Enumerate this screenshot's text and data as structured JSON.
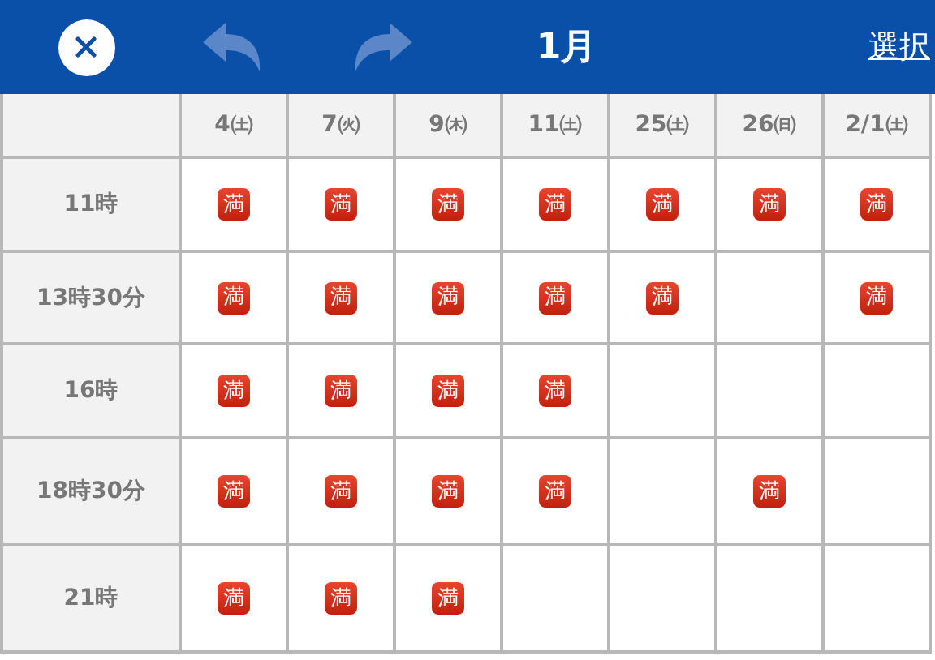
{
  "toolbar": {
    "close_disabled": false,
    "undo_disabled": true,
    "redo_disabled": true,
    "title": "1月",
    "select_label": "選択"
  },
  "table": {
    "columns": [
      "4㈯",
      "7㈫",
      "9㈭",
      "11㈯",
      "25㈯",
      "26㈰",
      "2/1㈯"
    ],
    "rows": [
      {
        "time": "11時",
        "cells": [
          "満",
          "満",
          "満",
          "満",
          "満",
          "満",
          "満"
        ]
      },
      {
        "time": "13時30分",
        "cells": [
          "満",
          "満",
          "満",
          "満",
          "満",
          null,
          "満"
        ]
      },
      {
        "time": "16時",
        "cells": [
          "満",
          "満",
          "満",
          "満",
          null,
          null,
          null
        ]
      },
      {
        "time": "18時30分",
        "cells": [
          "満",
          "満",
          "満",
          "満",
          null,
          "満",
          null
        ]
      },
      {
        "time": "21時",
        "cells": [
          "満",
          "満",
          "満",
          null,
          null,
          null,
          null
        ]
      }
    ]
  }
}
